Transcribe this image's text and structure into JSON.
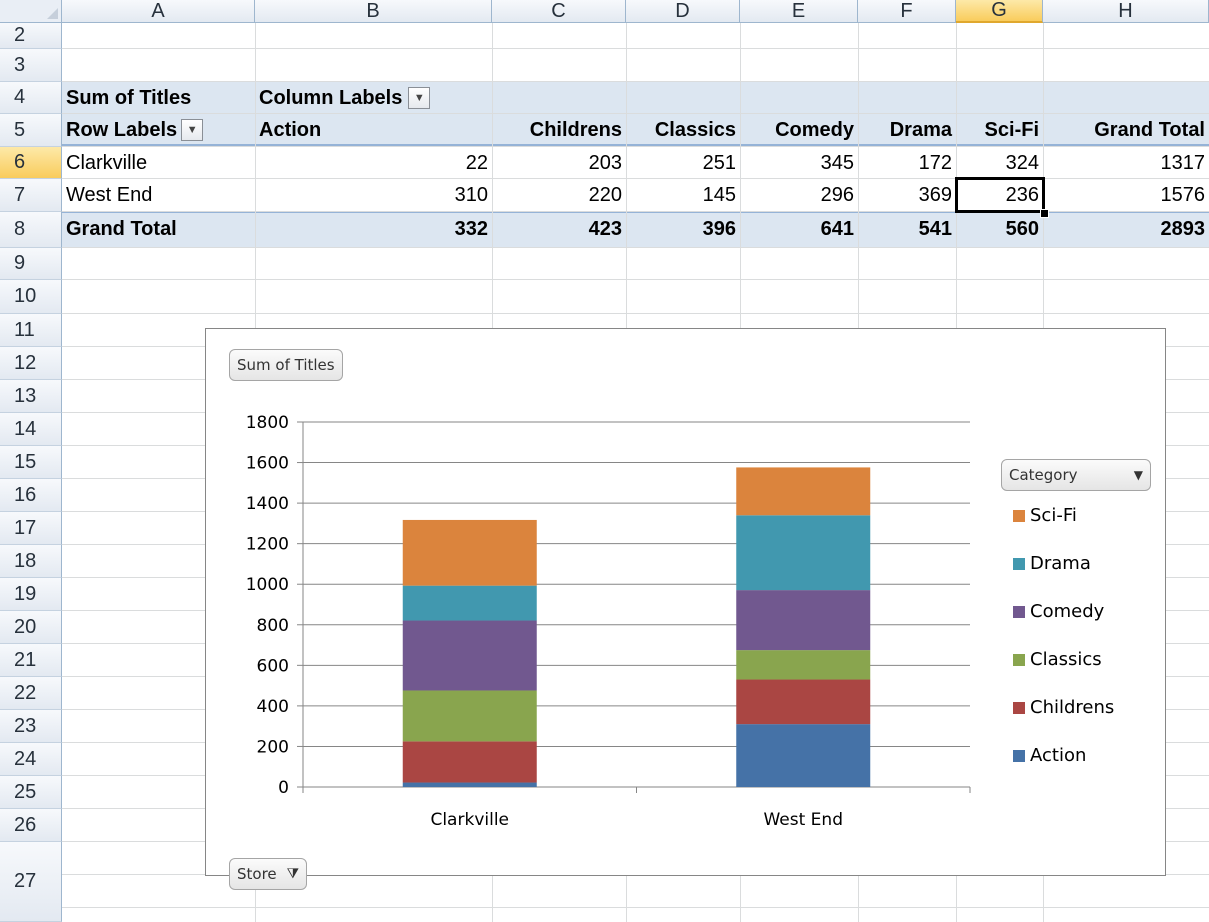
{
  "spreadsheet": {
    "columns": [
      "A",
      "B",
      "C",
      "D",
      "E",
      "F",
      "G",
      "H"
    ],
    "selected_column": "G",
    "rows": [
      "2",
      "3",
      "4",
      "5",
      "6",
      "7",
      "8",
      "9",
      "10",
      "11",
      "12",
      "13",
      "14",
      "15",
      "16",
      "17",
      "18",
      "19",
      "20",
      "21",
      "22",
      "23",
      "24",
      "25",
      "26",
      "27"
    ],
    "selected_row": "6"
  },
  "pivot": {
    "value_field": "Sum of Titles",
    "column_labels": "Column Labels",
    "row_labels": "Row Labels",
    "headers": [
      "Action",
      "Childrens",
      "Classics",
      "Comedy",
      "Drama",
      "Sci-Fi",
      "Grand Total"
    ],
    "rows": [
      {
        "label": "Clarkville",
        "values": [
          "22",
          "203",
          "251",
          "345",
          "172",
          "324",
          "1317"
        ]
      },
      {
        "label": "West End",
        "values": [
          "310",
          "220",
          "145",
          "296",
          "369",
          "236",
          "1576"
        ]
      }
    ],
    "grand_total": {
      "label": "Grand Total",
      "values": [
        "332",
        "423",
        "396",
        "641",
        "541",
        "560",
        "2893"
      ]
    },
    "selected_cell_value": "236"
  },
  "chart_controls": {
    "value_button": "Sum of Titles",
    "legend_button": "Category",
    "axis_button": "Store"
  },
  "chart_data": {
    "type": "bar",
    "stacked": true,
    "categories": [
      "Clarkville",
      "West End"
    ],
    "series": [
      {
        "name": "Action",
        "color": "#4572a7",
        "values": [
          22,
          310
        ]
      },
      {
        "name": "Childrens",
        "color": "#aa4643",
        "values": [
          203,
          220
        ]
      },
      {
        "name": "Classics",
        "color": "#89a54e",
        "values": [
          251,
          145
        ]
      },
      {
        "name": "Comedy",
        "color": "#71588f",
        "values": [
          345,
          296
        ]
      },
      {
        "name": "Drama",
        "color": "#4198af",
        "values": [
          172,
          369
        ]
      },
      {
        "name": "Sci-Fi",
        "color": "#db843d",
        "values": [
          324,
          236
        ]
      }
    ],
    "ylim": [
      0,
      1800
    ],
    "yticks": [
      "0",
      "200",
      "400",
      "600",
      "800",
      "1000",
      "1200",
      "1400",
      "1600",
      "1800"
    ],
    "grid": true,
    "legend_position": "right",
    "legend_order": [
      "Sci-Fi",
      "Drama",
      "Comedy",
      "Classics",
      "Childrens",
      "Action"
    ]
  }
}
